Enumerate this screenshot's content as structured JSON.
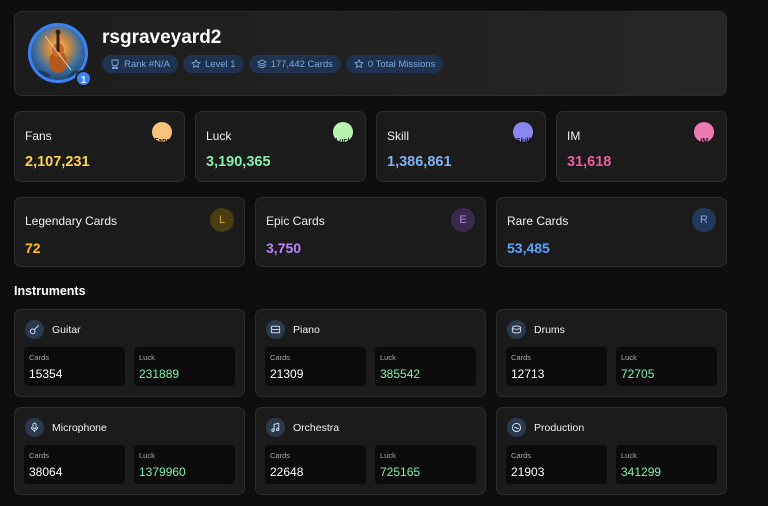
{
  "profile": {
    "username": "rsgraveyard2",
    "level_badge": "1",
    "badges": [
      {
        "icon": "trophy-icon",
        "label": "Rank #N/A"
      },
      {
        "icon": "star-icon",
        "label": "Level 1"
      },
      {
        "icon": "layers-icon",
        "label": "177,442 Cards"
      },
      {
        "icon": "star-icon",
        "label": "0 Total Missions"
      }
    ]
  },
  "stats": [
    {
      "label": "Fans",
      "value": "2,107,231",
      "icon_text": "Fans",
      "color": "#fcd34d",
      "icon_bg": "#f8c27a"
    },
    {
      "label": "Luck",
      "value": "3,190,365",
      "icon_text": "Luck",
      "color": "#86efac",
      "icon_bg": "#b8f5b0"
    },
    {
      "label": "Skill",
      "value": "1,386,861",
      "icon_text": "Skill",
      "color": "#7fb2f0",
      "icon_bg": "#8b86f2"
    },
    {
      "label": "IM",
      "value": "31,618",
      "icon_text": "IM",
      "color": "#ec5f9a",
      "icon_bg": "#f07ab2"
    }
  ],
  "rarities": [
    {
      "label": "Legendary Cards",
      "value": "72",
      "letter": "L",
      "color": "#fbbf24",
      "circle_bg": "#4a3d12",
      "circle_fg": "#d4a32a"
    },
    {
      "label": "Epic Cards",
      "value": "3,750",
      "letter": "E",
      "color": "#c084fc",
      "circle_bg": "#3a2a4e",
      "circle_fg": "#a98bd0"
    },
    {
      "label": "Rare Cards",
      "value": "53,485",
      "letter": "R",
      "color": "#60a5fa",
      "circle_bg": "#22385a",
      "circle_fg": "#7aa6e0"
    }
  ],
  "instruments_title": "Instruments",
  "metric_labels": {
    "cards": "Cards",
    "luck": "Luck"
  },
  "instruments": [
    {
      "name": "Guitar",
      "icon": "guitar-icon",
      "cards": "15354",
      "luck": "231889"
    },
    {
      "name": "Piano",
      "icon": "piano-icon",
      "cards": "21309",
      "luck": "385542"
    },
    {
      "name": "Drums",
      "icon": "drum-icon",
      "cards": "12713",
      "luck": "72705"
    },
    {
      "name": "Microphone",
      "icon": "microphone-icon",
      "cards": "38064",
      "luck": "1379960"
    },
    {
      "name": "Orchestra",
      "icon": "music-note-icon",
      "cards": "22648",
      "luck": "725165"
    },
    {
      "name": "Production",
      "icon": "disc-icon",
      "cards": "21903",
      "luck": "341299"
    }
  ]
}
